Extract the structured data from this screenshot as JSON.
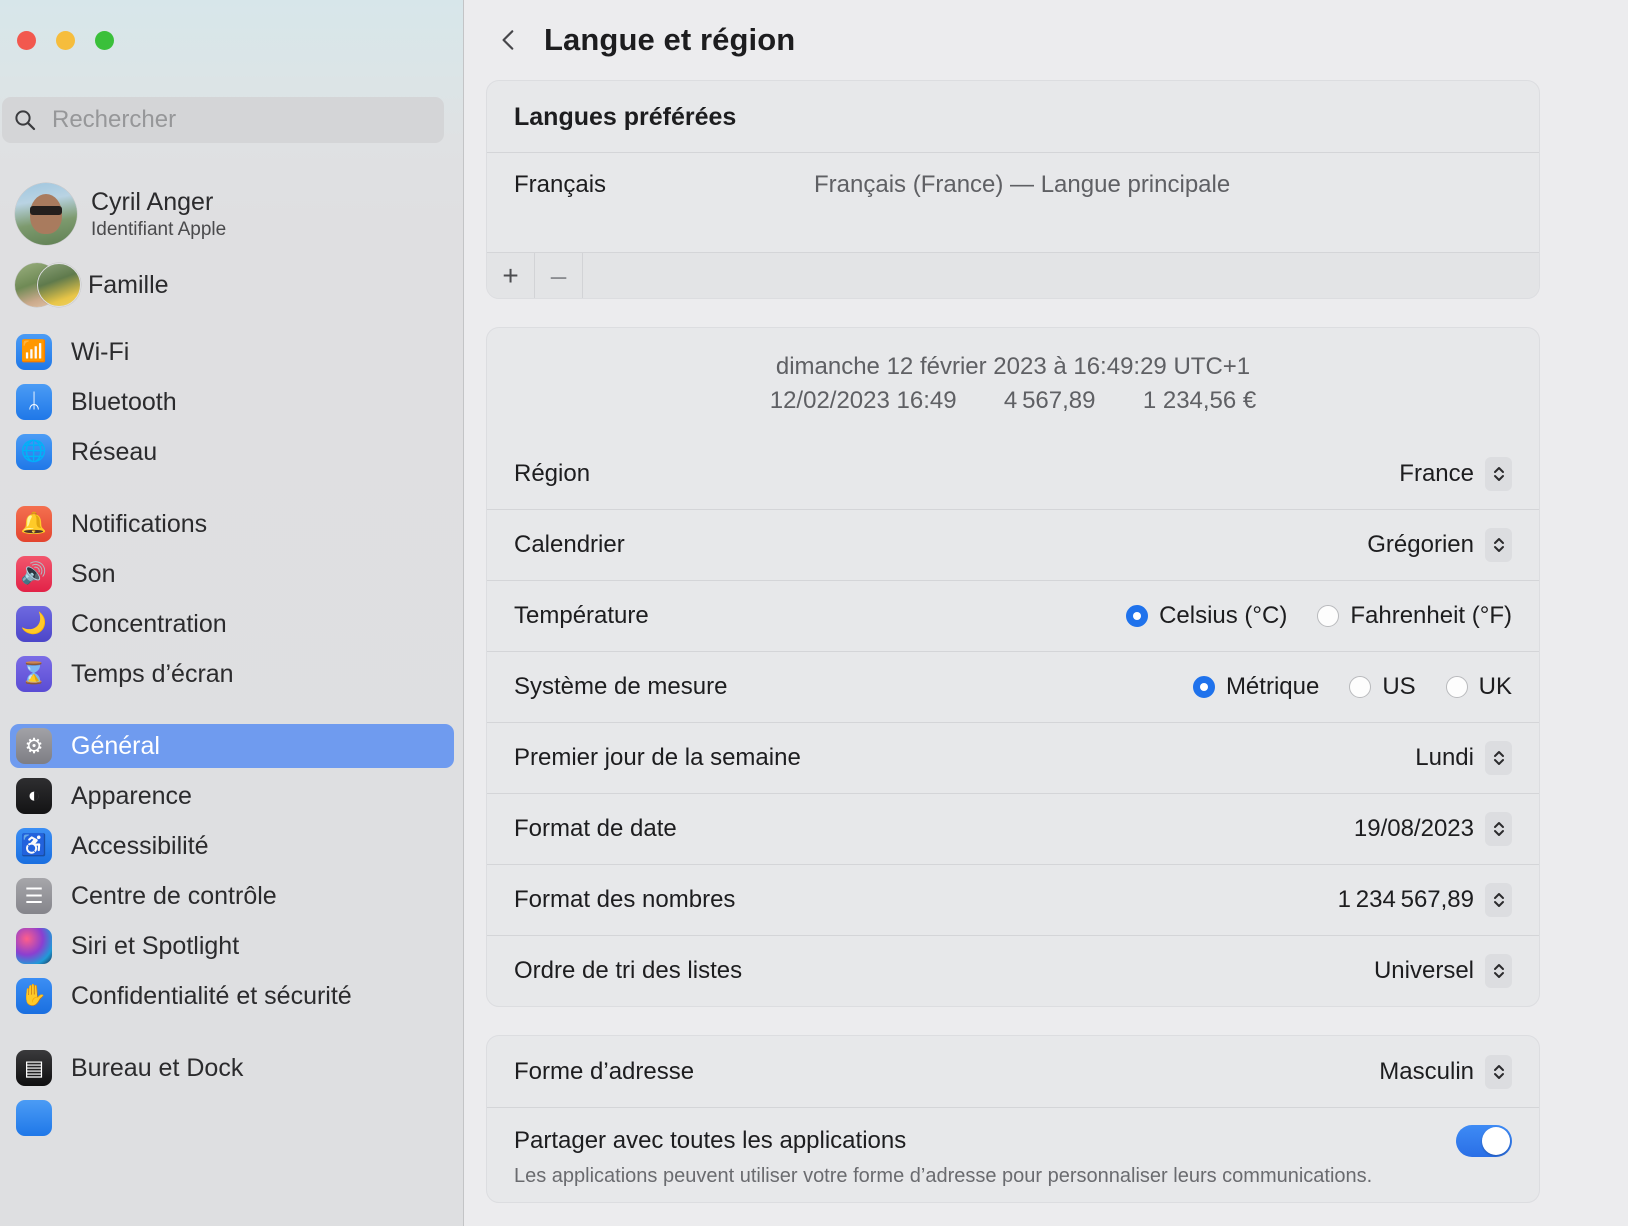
{
  "window": {
    "traffic_lights": [
      "close",
      "minimize",
      "zoom"
    ]
  },
  "sidebar": {
    "search": {
      "placeholder": "Rechercher",
      "value": ""
    },
    "account": {
      "name": "Cyril Anger",
      "subtitle": "Identifiant Apple"
    },
    "family": {
      "label": "Famille"
    },
    "groups": [
      {
        "items": [
          {
            "label": "Wi-Fi",
            "icon": "wifi-icon",
            "icon_class": "ic-wifi",
            "glyph": "📶",
            "selected": false
          },
          {
            "label": "Bluetooth",
            "icon": "bluetooth-icon",
            "icon_class": "ic-bt",
            "glyph": "ᛦ",
            "selected": false
          },
          {
            "label": "Réseau",
            "icon": "globe-icon",
            "icon_class": "ic-net",
            "glyph": "🌐",
            "selected": false
          }
        ]
      },
      {
        "items": [
          {
            "label": "Notifications",
            "icon": "bell-icon",
            "icon_class": "ic-notif",
            "glyph": "🔔",
            "selected": false
          },
          {
            "label": "Son",
            "icon": "speaker-icon",
            "icon_class": "ic-son",
            "glyph": "🔊",
            "selected": false
          },
          {
            "label": "Concentration",
            "icon": "moon-icon",
            "icon_class": "ic-focus",
            "glyph": "🌙",
            "selected": false
          },
          {
            "label": "Temps d’écran",
            "icon": "hourglass-icon",
            "icon_class": "ic-screen",
            "glyph": "⌛",
            "selected": false
          }
        ]
      },
      {
        "items": [
          {
            "label": "Général",
            "icon": "gear-icon",
            "icon_class": "ic-gen",
            "glyph": "⚙",
            "selected": true
          },
          {
            "label": "Apparence",
            "icon": "appearance-icon",
            "icon_class": "ic-app",
            "glyph": "◐",
            "selected": false
          },
          {
            "label": "Accessibilité",
            "icon": "accessibility-icon",
            "icon_class": "ic-acc",
            "glyph": "♿",
            "selected": false
          },
          {
            "label": "Centre de contrôle",
            "icon": "control-center-icon",
            "icon_class": "ic-cc",
            "glyph": "☰",
            "selected": false
          },
          {
            "label": "Siri et Spotlight",
            "icon": "siri-icon",
            "icon_class": "ic-siri",
            "glyph": "",
            "selected": false
          },
          {
            "label": "Confidentialité et sécurité",
            "icon": "hand-icon",
            "icon_class": "ic-priv",
            "glyph": "✋",
            "selected": false
          }
        ]
      },
      {
        "items": [
          {
            "label": "Bureau et Dock",
            "icon": "dock-icon",
            "icon_class": "ic-dock",
            "glyph": "▤",
            "selected": false
          },
          {
            "label": "",
            "icon": "display-icon",
            "icon_class": "ic-disp",
            "glyph": "",
            "selected": false
          }
        ]
      }
    ]
  },
  "header": {
    "back_icon": "chevron-left-icon",
    "title": "Langue et région"
  },
  "languages_card": {
    "title": "Langues préférées",
    "rows": [
      {
        "name": "Français",
        "description": "Français (France) — Langue principale"
      }
    ],
    "toolbar": {
      "add_label": "+",
      "remove_label": "–"
    }
  },
  "preview": {
    "line1": "dimanche 12 février 2023 à 16:49:29 UTC+1",
    "line2_datetime": "12/02/2023 16:49",
    "line2_number": "4 567,89",
    "line2_currency": "1 234,56 €"
  },
  "settings": [
    {
      "label": "Région",
      "type": "popup",
      "value": "France"
    },
    {
      "label": "Calendrier",
      "type": "popup",
      "value": "Grégorien"
    },
    {
      "label": "Température",
      "type": "radio",
      "options": [
        {
          "label": "Celsius (°C)",
          "selected": true
        },
        {
          "label": "Fahrenheit (°F)",
          "selected": false
        }
      ]
    },
    {
      "label": "Système de mesure",
      "type": "radio",
      "options": [
        {
          "label": "Métrique",
          "selected": true
        },
        {
          "label": "US",
          "selected": false
        },
        {
          "label": "UK",
          "selected": false
        }
      ]
    },
    {
      "label": "Premier jour de la semaine",
      "type": "popup",
      "value": "Lundi"
    },
    {
      "label": "Format de date",
      "type": "popup",
      "value": "19/08/2023"
    },
    {
      "label": "Format des nombres",
      "type": "popup",
      "value": "1 234 567,89"
    },
    {
      "label": "Ordre de tri des listes",
      "type": "popup",
      "value": "Universel"
    }
  ],
  "address_card": {
    "rows": [
      {
        "label": "Forme d’adresse",
        "type": "popup",
        "value": "Masculin"
      }
    ],
    "share": {
      "label": "Partager avec toutes les applications",
      "description": "Les applications peuvent utiliser votre forme d’adresse pour personnaliser leurs communications.",
      "enabled": true
    }
  },
  "colors": {
    "accent": "#1f72ec",
    "selection": "#6f9bef",
    "card_bg": "#e7e8ea",
    "pane_bg": "#ececee"
  }
}
